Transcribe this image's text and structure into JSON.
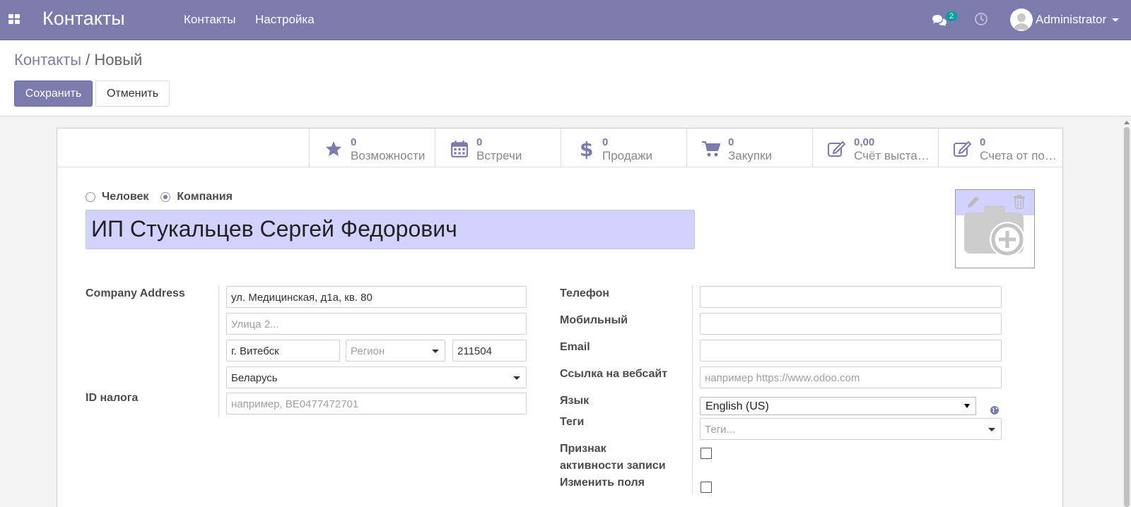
{
  "navbar": {
    "app_title": "Контакты",
    "menu": [
      "Контакты",
      "Настройка"
    ],
    "messages_count": "2",
    "user_name": "Administrator"
  },
  "breadcrumb": {
    "parent": "Контакты",
    "separator": "/",
    "current": "Новый"
  },
  "buttons": {
    "save": "Сохранить",
    "discard": "Отменить"
  },
  "smart_buttons": [
    {
      "value": "0",
      "label": "Возможности",
      "icon": "star-icon"
    },
    {
      "value": "0",
      "label": "Встречи",
      "icon": "calendar-icon"
    },
    {
      "value": "0",
      "label": "Продажи",
      "icon": "dollar-icon"
    },
    {
      "value": "0",
      "label": "Закупки",
      "icon": "cart-icon"
    },
    {
      "value": "0,00",
      "label": "Счёт выста…",
      "icon": "edit-icon"
    },
    {
      "value": "0",
      "label": "Счета от по…",
      "icon": "edit-icon"
    }
  ],
  "company_type": {
    "person": "Человек",
    "company": "Компания",
    "selected": "company"
  },
  "name": "ИП Стукальцев Сергей Федорович",
  "address": {
    "label": "Company Address",
    "street": "ул. Медицинская, д1а, кв. 80",
    "street2_placeholder": "Улица 2...",
    "city": "г. Витебск",
    "state_placeholder": "Регион",
    "zip": "211504",
    "country": "Беларусь"
  },
  "vat": {
    "label": "ID налога",
    "placeholder": "например, BE0477472701"
  },
  "right_fields": {
    "phone_label": "Телефон",
    "mobile_label": "Мобильный",
    "email_label": "Email",
    "website_label": "Ссылка на вебсайт",
    "website_placeholder": "например https://www.odoo.com",
    "lang_label": "Язык",
    "lang_value": "English (US)",
    "tags_label": "Теги",
    "tags_placeholder": "Теги...",
    "active_label_1": "Признак",
    "active_label_2": "активности записи",
    "edit_fields_label": "Изменить поля"
  },
  "colors": {
    "brand": "#7c7bad",
    "name_field_bg": "#d2d2ff",
    "badge": "#00a09d"
  }
}
